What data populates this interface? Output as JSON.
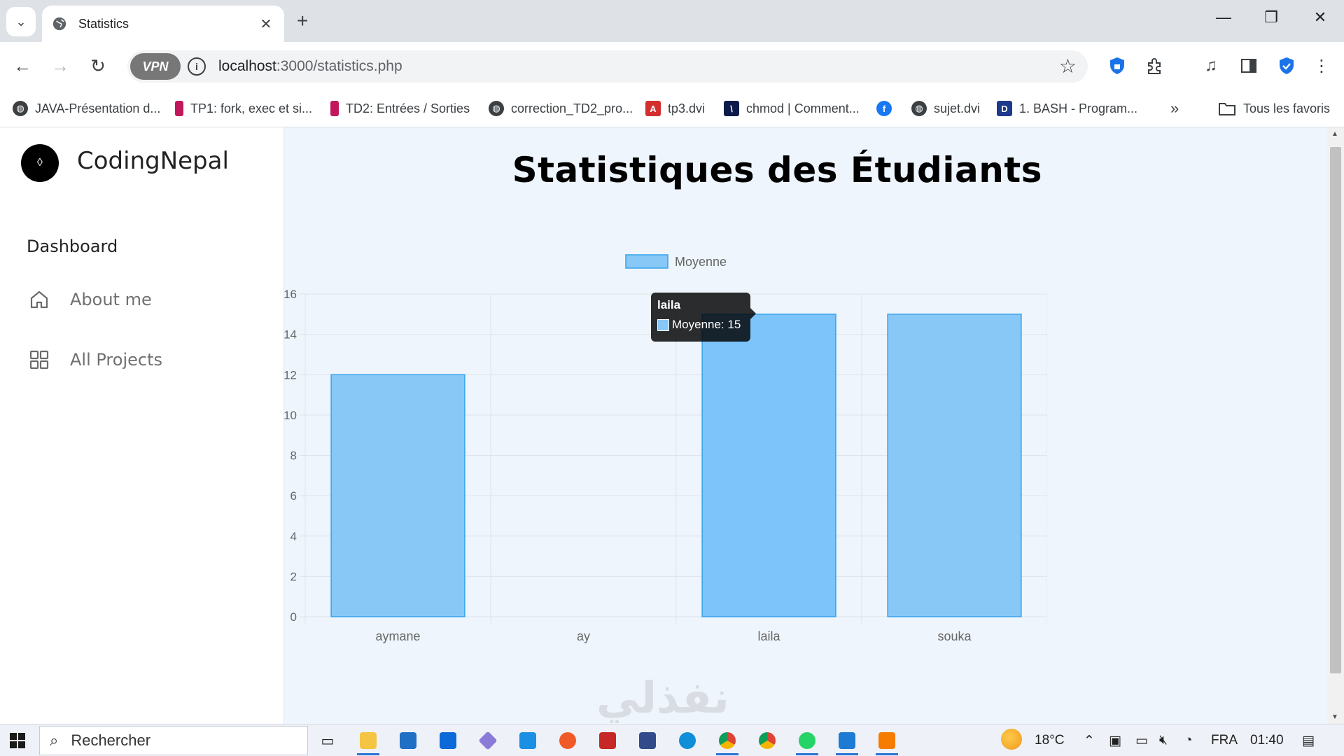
{
  "browser": {
    "tab_title": "Statistics",
    "url_host": "localhost",
    "url_path": ":3000/statistics.php",
    "vpn_label": "VPN",
    "bookmarks": [
      {
        "label": "JAVA-Présentation d...",
        "icon": "globe-icon",
        "color": "#3c4043"
      },
      {
        "label": "TP1: fork, exec et si...",
        "icon": "page-icon",
        "color": "#c2185b"
      },
      {
        "label": "TD2: Entrées / Sorties",
        "icon": "page-icon",
        "color": "#c2185b"
      },
      {
        "label": "correction_TD2_pro...",
        "icon": "globe-icon",
        "color": "#3c4043"
      },
      {
        "label": "tp3.dvi",
        "icon": "pdf-icon",
        "color": "#d32f2f"
      },
      {
        "label": "chmod | Comment...",
        "icon": "site-icon",
        "color": "#0d1b4c"
      },
      {
        "label": "",
        "icon": "facebook-icon",
        "color": "#1877f2"
      },
      {
        "label": "sujet.dvi",
        "icon": "globe-icon",
        "color": "#3c4043"
      },
      {
        "label": "1. BASH - Program...",
        "icon": "site-icon",
        "color": "#1e3a8a"
      }
    ],
    "all_bookmarks_label": "Tous les favoris"
  },
  "sidebar": {
    "brand": "CodingNepal",
    "section": "Dashboard",
    "items": [
      {
        "label": "About me",
        "icon": "home-icon"
      },
      {
        "label": "All Projects",
        "icon": "grid-icon"
      }
    ]
  },
  "main": {
    "title": "Statistiques des Étudiants"
  },
  "chart_data": {
    "type": "bar",
    "categories": [
      "aymane",
      "ay",
      "laila",
      "souka"
    ],
    "series": [
      {
        "name": "Moyenne",
        "values": [
          12,
          0,
          15,
          15
        ]
      }
    ],
    "ylim": [
      0,
      16
    ],
    "yticks": [
      "0",
      "2",
      "4",
      "6",
      "8",
      "10",
      "12",
      "14",
      "16"
    ],
    "grid": true,
    "legend": "top",
    "bar_color": "#88c8f7",
    "bar_border": "#36a2eb",
    "tooltip": {
      "title": "laila",
      "label": "Moyenne: 15"
    }
  },
  "watermark": "نفذلي",
  "taskbar": {
    "search_placeholder": "Rechercher",
    "weather": "18°C",
    "language": "FRA",
    "time": "01:40"
  }
}
